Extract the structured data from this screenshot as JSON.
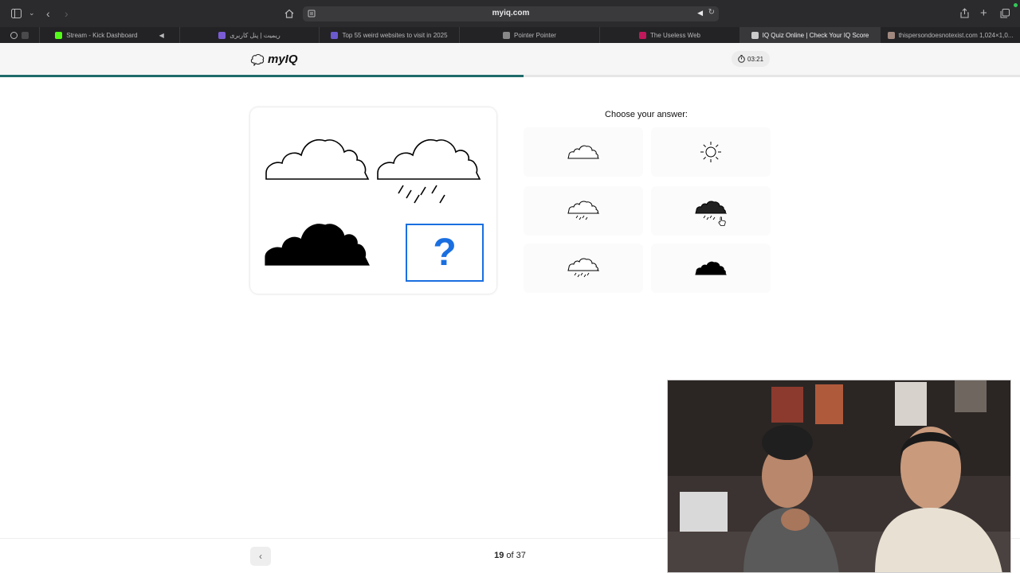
{
  "browser": {
    "url": "myiq.com",
    "icons": {
      "sidebar": "sidebar-icon",
      "back": "back-arrow-icon",
      "forward": "forward-arrow-icon",
      "home": "home-icon",
      "reader": "reader-icon",
      "audio": "speaker-icon",
      "reload": "reload-icon",
      "share": "share-icon",
      "new_tab": "plus-icon",
      "tabs_overview": "tabs-overview-icon"
    },
    "tabs": [
      {
        "title": "",
        "favicon_color": "#4a4a4c"
      },
      {
        "title": "Stream - Kick Dashboard",
        "favicon_color": "#53fc18"
      },
      {
        "title": "ریمیت | پنل کاربری",
        "favicon_color": "#7b5cd6"
      },
      {
        "title": "Top 55 weird websites to visit in 2025",
        "favicon_color": "#6a5acd"
      },
      {
        "title": "Pointer Pointer",
        "favicon_color": "#888888"
      },
      {
        "title": "The Useless Web",
        "favicon_color": "#c2185b"
      },
      {
        "title": "IQ Quiz Online | Check Your IQ Score",
        "favicon_color": "#cccccc"
      },
      {
        "title": "thispersondoesnotexist.com 1,024×1,0...",
        "favicon_color": "#a1887f"
      }
    ]
  },
  "site": {
    "logo_text": "myIQ",
    "timer": "03:21",
    "progress_percent": 51.3
  },
  "puzzle": {
    "cells": [
      "cloud-outline",
      "cloud-outline-with-rain",
      "cloud-filled",
      "question"
    ],
    "question_mark": "?"
  },
  "answers": {
    "title": "Choose your answer:",
    "options": [
      {
        "icon": "cloud-outline-icon"
      },
      {
        "icon": "sun-icon"
      },
      {
        "icon": "cloud-outline-rain-icon"
      },
      {
        "icon": "cloud-filled-rain-icon"
      },
      {
        "icon": "cloud-outline-rain-icon"
      },
      {
        "icon": "cloud-filled-icon"
      }
    ]
  },
  "footer": {
    "current": "19",
    "of_text": "of 37"
  }
}
